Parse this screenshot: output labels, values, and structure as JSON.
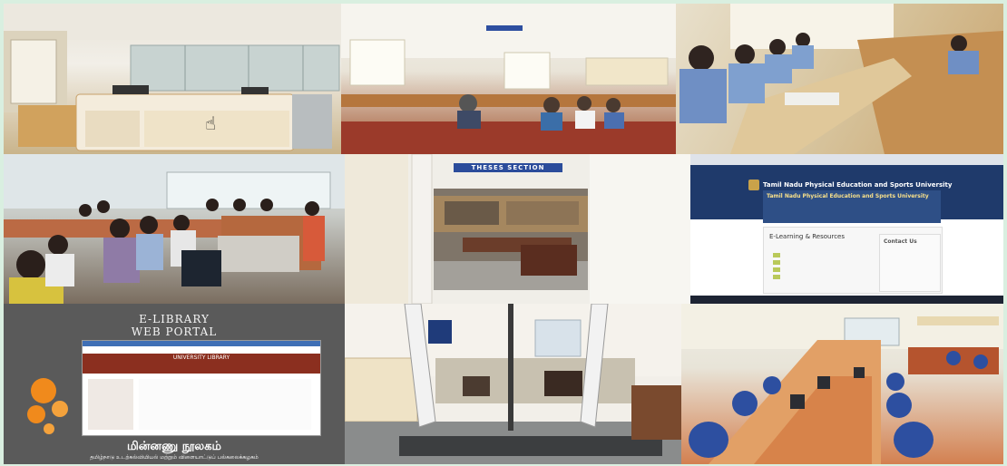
{
  "collage": {
    "background": "#d9efe0",
    "tiles": [
      {
        "id": "circulation-desk"
      },
      {
        "id": "reading-hall"
      },
      {
        "id": "students-reading"
      },
      {
        "id": "orientation-session"
      },
      {
        "id": "thesis-section",
        "sign": "THESES SECTION"
      },
      {
        "id": "library-website",
        "site_title": "Tamil Nadu Physical Education and Sports University",
        "banner_title": "Tamil Nadu Physical Education and Sports University",
        "card_title": "E-Learning & Resources",
        "contact_title": "Contact Us"
      },
      {
        "id": "e-library-portal",
        "title_line1": "E-LIBRARY",
        "title_line2": "WEB PORTAL",
        "portal_header": "UNIVERSITY LIBRARY",
        "tamil_title": "மின்னணு நூலகம்",
        "tamil_subtitle": "தமிழ்நாடு உடற்கல்வியியல் மற்றும் விளையாட்டுப் பல்கலைக்கழகம்"
      },
      {
        "id": "security-gates"
      },
      {
        "id": "computer-lab"
      }
    ]
  }
}
